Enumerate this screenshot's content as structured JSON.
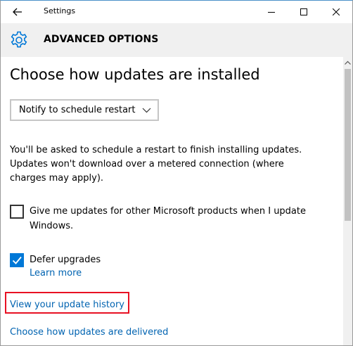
{
  "window": {
    "title": "Settings"
  },
  "header": {
    "title": "ADVANCED OPTIONS",
    "icon": "gear-icon",
    "accent": "#0078d7"
  },
  "main": {
    "page_title": "Choose how updates are installed",
    "dropdown": {
      "selected": "Notify to schedule restart"
    },
    "description": "You'll be asked to schedule a restart to finish installing updates. Updates won't download over a metered connection (where charges may apply).",
    "options": [
      {
        "label": "Give me updates for other Microsoft products when I update Windows.",
        "checked": false
      },
      {
        "label": "Defer upgrades",
        "checked": true
      }
    ],
    "learn_more": "Learn more",
    "view_history": "View your update history",
    "choose_delivered": "Choose how updates are delivered"
  },
  "colors": {
    "link": "#0063b1",
    "highlight_border": "#e81123",
    "header_bg": "#f0f0f0"
  }
}
